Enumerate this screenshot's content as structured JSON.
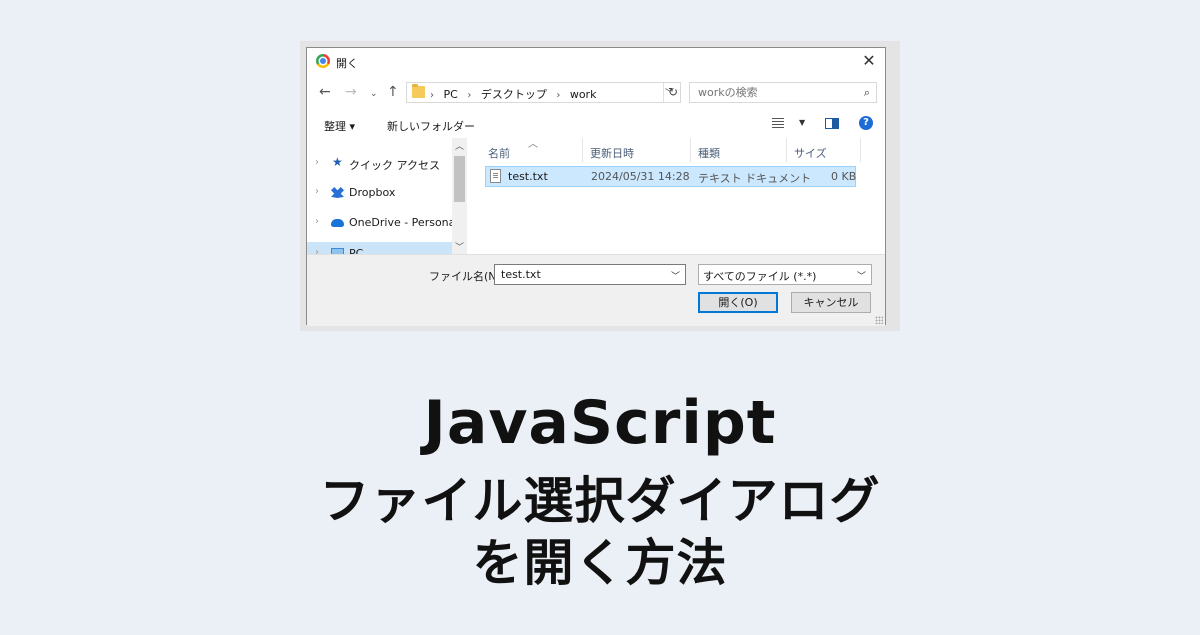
{
  "dialog": {
    "title": "開く",
    "breadcrumb": [
      "PC",
      "デスクトップ",
      "work"
    ],
    "search_placeholder": "workの検索",
    "toolbar": {
      "organize": "整理 ▾",
      "new_folder": "新しいフォルダー"
    },
    "nav_items": [
      {
        "label": "クイック アクセス",
        "icon": "star-icon"
      },
      {
        "label": "Dropbox",
        "icon": "dropbox-icon"
      },
      {
        "label": "OneDrive - Personal",
        "icon": "onedrive-icon"
      },
      {
        "label": "PC",
        "icon": "pc-icon"
      }
    ],
    "columns": [
      "名前",
      "更新日時",
      "種類",
      "サイズ"
    ],
    "files": [
      {
        "name": "test.txt",
        "modified": "2024/05/31 14:28",
        "type": "テキスト ドキュメント",
        "size": "0 KB"
      }
    ],
    "filename_label": "ファイル名(N):",
    "filename_value": "test.txt",
    "file_type": "すべてのファイル (*.*)",
    "open_button": "開く(O)",
    "cancel_button": "キャンセル"
  },
  "headline": {
    "line1": "JavaScript",
    "line2": "ファイル選択ダイアログ",
    "line3": "を開く方法"
  }
}
